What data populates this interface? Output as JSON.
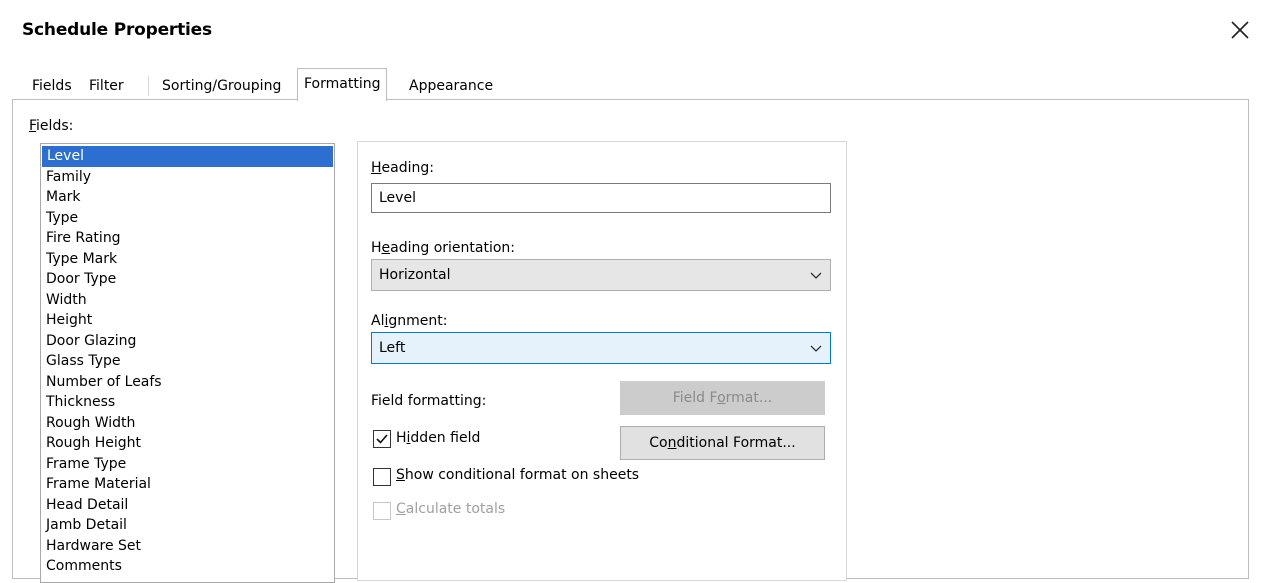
{
  "window": {
    "title": "Schedule Properties"
  },
  "tabs": [
    {
      "label": "Fields"
    },
    {
      "label": "Filter"
    },
    {
      "label": "Sorting/Grouping"
    },
    {
      "label": "Formatting"
    },
    {
      "label": "Appearance"
    }
  ],
  "active_tab": "Formatting",
  "fields": {
    "label": "Fields:",
    "selected": "Level",
    "items": [
      "Level",
      "Family",
      "Mark",
      "Type",
      "Fire Rating",
      "Type Mark",
      "Door Type",
      "Width",
      "Height",
      "Door Glazing",
      "Glass Type",
      "Number of Leafs",
      "Thickness",
      "Rough Width",
      "Rough Height",
      "Frame Type",
      "Frame Material",
      "Head Detail",
      "Jamb Detail",
      "Hardware Set",
      "Comments"
    ]
  },
  "formatting": {
    "heading_label": "Heading:",
    "heading_value": "Level",
    "orientation_label": "Heading orientation:",
    "orientation_value": "Horizontal",
    "alignment_label": "Alignment:",
    "alignment_value": "Left",
    "field_formatting_label": "Field formatting:",
    "field_format_button": "Field Format...",
    "hidden_field_label": "Hidden field",
    "hidden_field_checked": true,
    "conditional_format_button": "Conditional Format...",
    "show_conditional_label": "Show conditional format on sheets",
    "show_conditional_checked": false,
    "calculate_totals_label": "Calculate totals",
    "calculate_totals_checked": false,
    "calculate_totals_enabled": false
  },
  "colors": {
    "selection": "#2c6fd0",
    "focus_border": "#0078d7",
    "disabled_button": "#cccccc"
  }
}
